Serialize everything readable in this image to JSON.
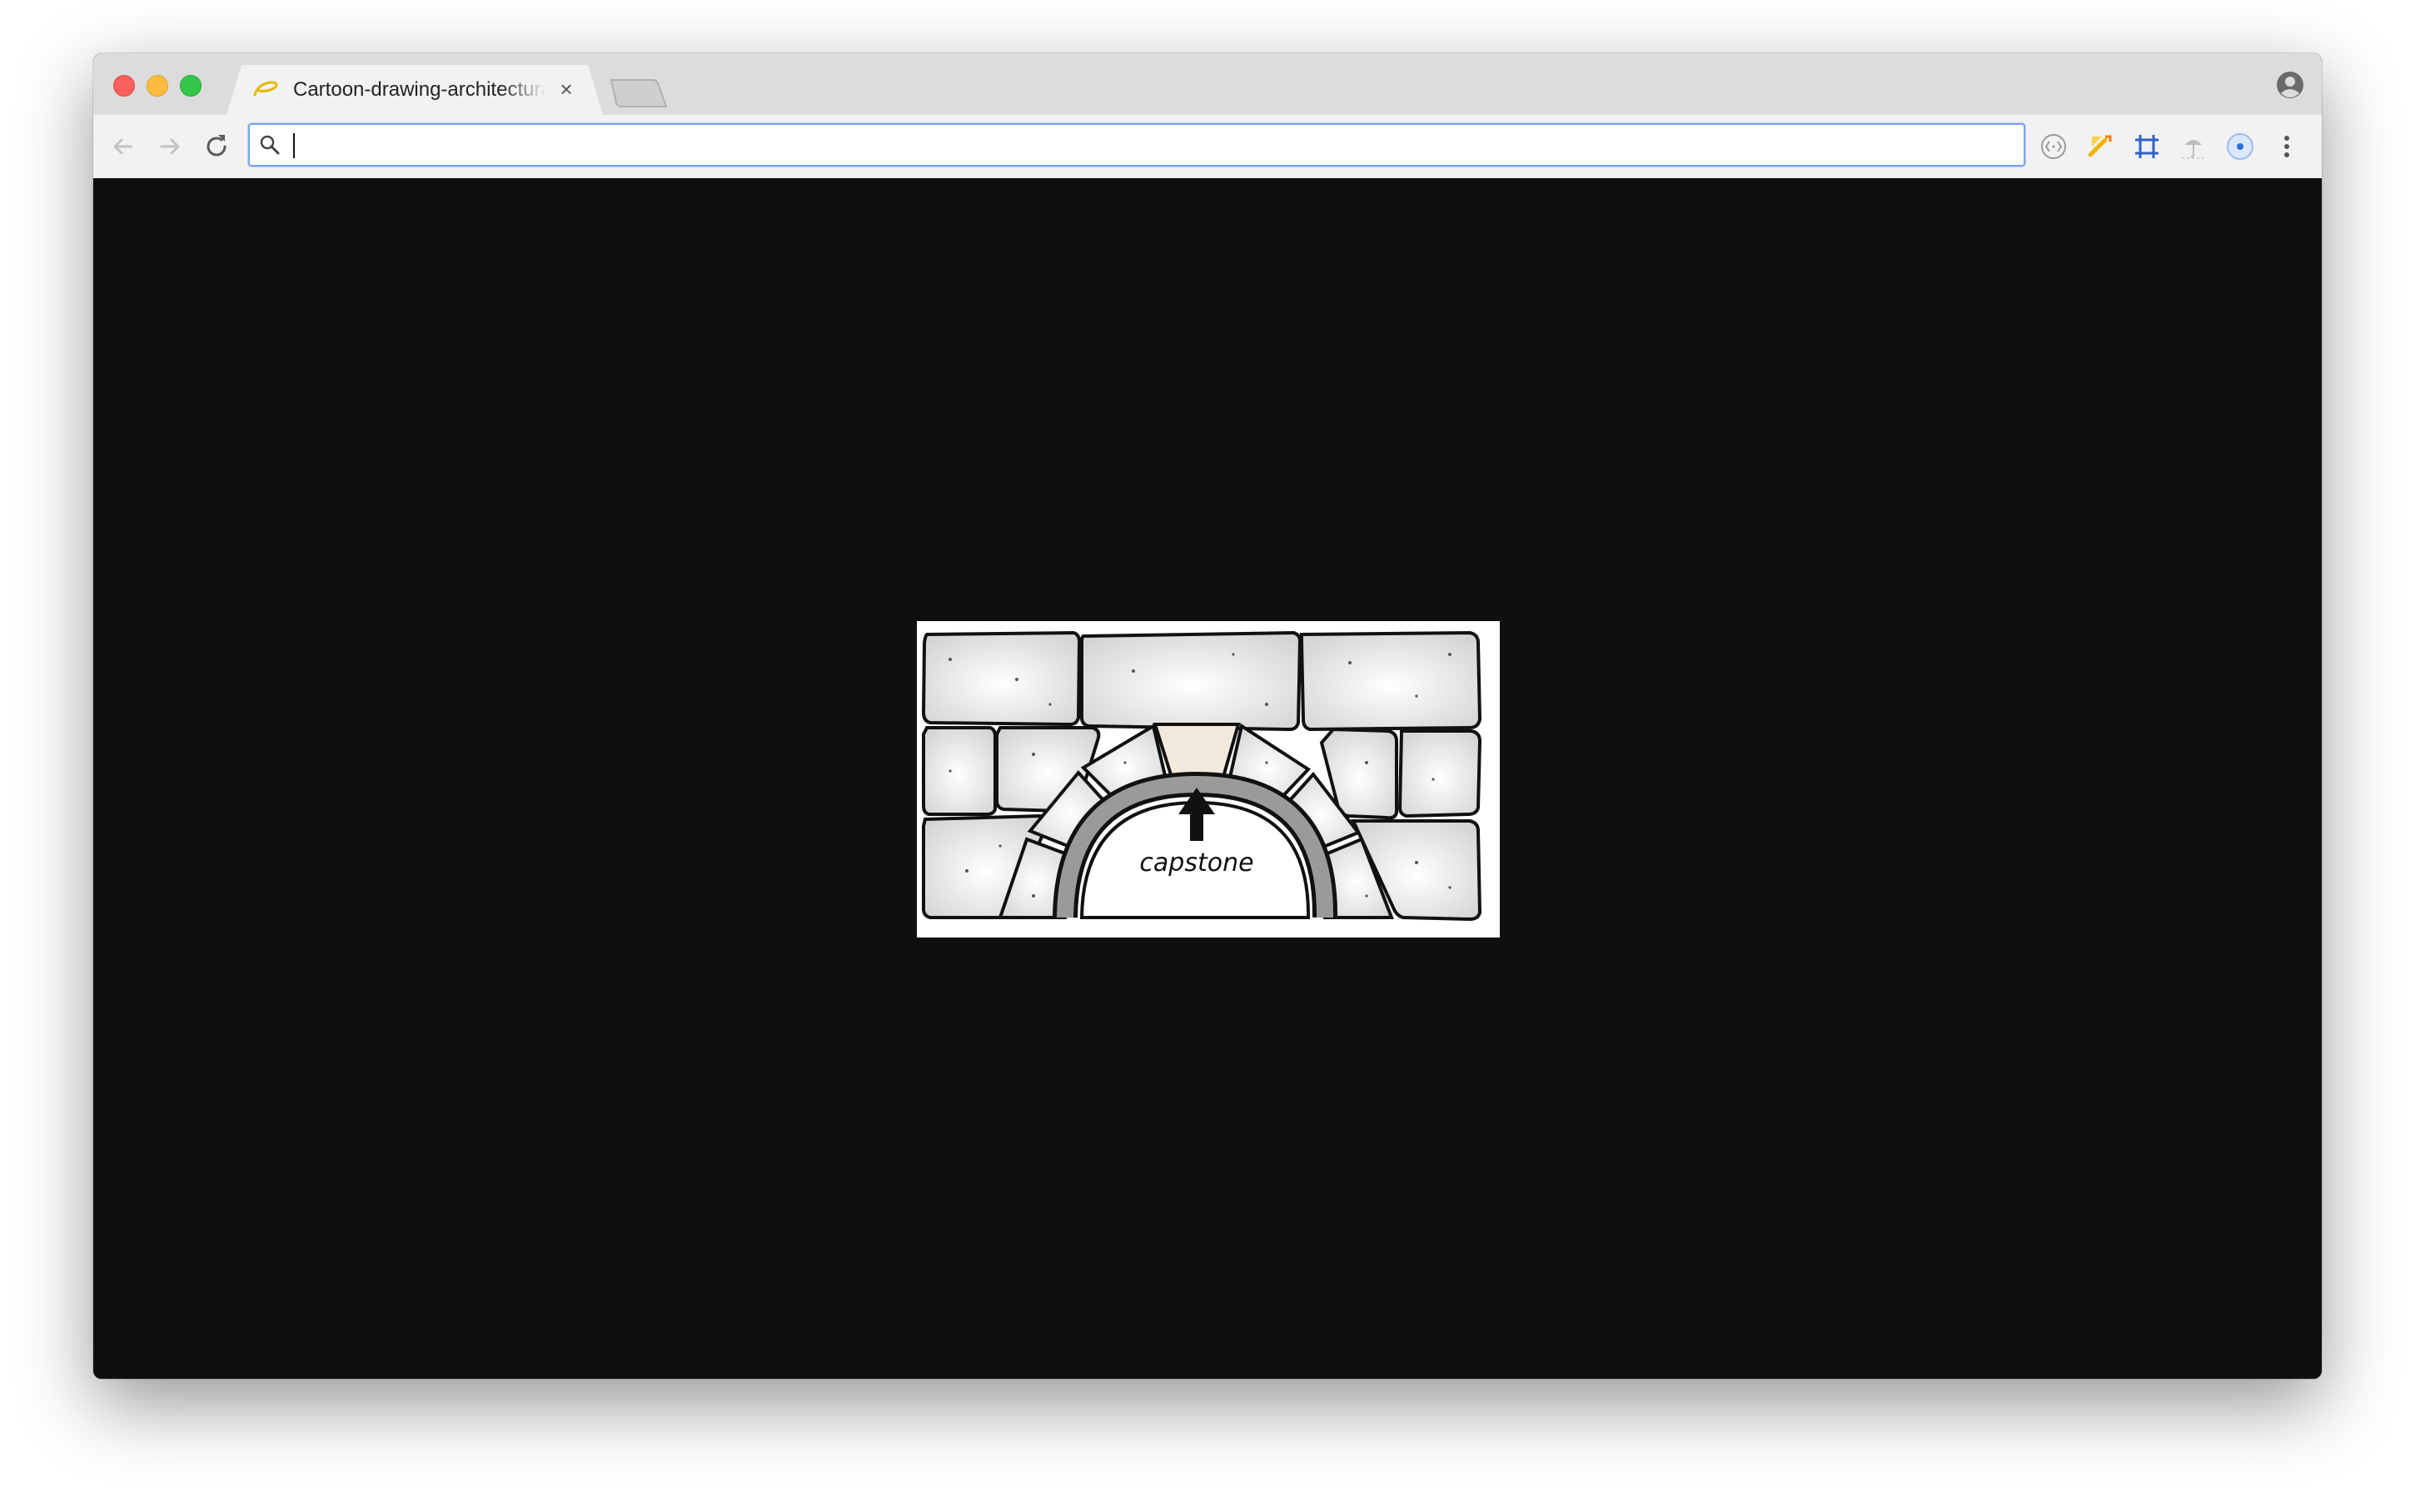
{
  "window": {
    "tab": {
      "title": "Cartoon-drawing-architectural-arch-capstone.jpg",
      "favicon": "yellow-swirl-icon",
      "close_label": "×"
    },
    "new_tab_label": "",
    "profile_icon": "profile-icon"
  },
  "toolbar": {
    "back_icon": "arrow-left-icon",
    "forward_icon": "arrow-right-icon",
    "reload_icon": "reload-icon",
    "omnibox": {
      "value": "",
      "placeholder": ""
    },
    "extensions": [
      "code-brackets-icon",
      "paint-wand-icon",
      "crop-grid-icon",
      "cloud-umbrella-icon",
      "blue-eye-icon"
    ],
    "menu_icon": "more-vert-icon"
  },
  "content": {
    "background": "#0f0f0f",
    "image": {
      "subject": "stone-arch-drawing",
      "label": "capstone"
    }
  },
  "colors": {
    "close": "#fc605c",
    "minimize": "#fdbc40",
    "maximize": "#34c749",
    "omnibox_focus": "#7aa6e9",
    "capstone_tint": "#f3e8dc"
  }
}
